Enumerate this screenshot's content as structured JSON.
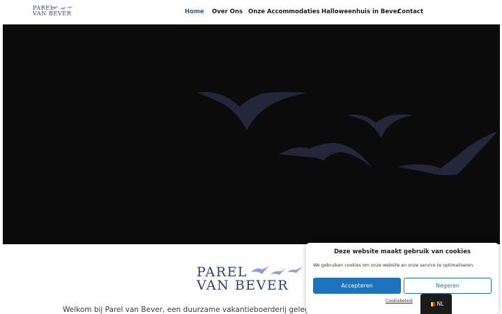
{
  "header": {
    "logo": {
      "line1": "PAREL",
      "line2": "VAN BEVER"
    },
    "nav": [
      {
        "label": "Home",
        "active": true
      },
      {
        "label": "Over Ons",
        "active": false
      },
      {
        "label": "Onze Accommodaties",
        "active": false
      },
      {
        "label": "Halloweenhuis in Bever",
        "active": false
      },
      {
        "label": "Contact",
        "active": false
      }
    ]
  },
  "hero": {
    "icon": "flying-birds"
  },
  "content": {
    "logo": {
      "line1": "PAREL",
      "line2": "VAN BEVER"
    },
    "intro": "Welkom bij Parel van Bever, een duurzame vakantieboerderij gelegen in het groene Bever, grenzend aan"
  },
  "cookie_banner": {
    "title": "Deze website maakt gebruik van cookies",
    "message": "We gebruiken cookies om onze website en onze service te optimaliseren.",
    "accept_label": "Accepteren",
    "deny_label": "Negeren",
    "policy_label": "Cookiebeleid"
  },
  "language_switcher": {
    "label": "NL",
    "flag": "belgium-flag"
  },
  "colors": {
    "brand_blue": "#2b3f7a",
    "nav_active": "#2a5e8e",
    "accept_button": "#1e73be",
    "hero_bg": "#0b0b0c"
  }
}
